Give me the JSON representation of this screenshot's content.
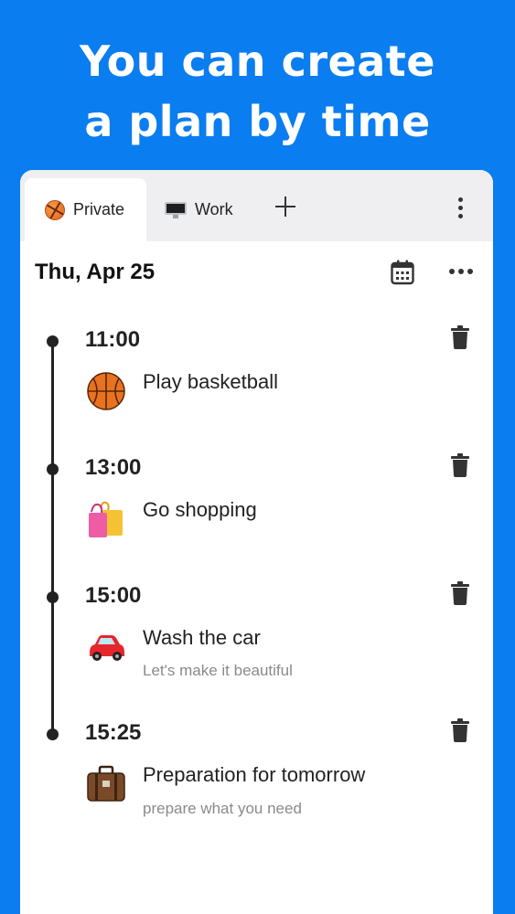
{
  "headline": {
    "line1": "You can create",
    "line2": "a plan by time"
  },
  "tabs": [
    {
      "label": "Private",
      "icon": "basketball-icon",
      "active": true
    },
    {
      "label": "Work",
      "icon": "computer-monitor-icon",
      "active": false
    }
  ],
  "header": {
    "date": "Thu, Apr 25"
  },
  "entries": [
    {
      "time": "11:00",
      "title": "Play basketball",
      "subtitle": "",
      "icon": "basketball-icon"
    },
    {
      "time": "13:00",
      "title": "Go shopping",
      "subtitle": "",
      "icon": "shopping-bags-icon"
    },
    {
      "time": "15:00",
      "title": "Wash the car",
      "subtitle": "Let's make it beautiful",
      "icon": "car-icon"
    },
    {
      "time": "15:25",
      "title": "Preparation for tomorrow",
      "subtitle": "prepare what you need",
      "icon": "suitcase-icon"
    }
  ],
  "colors": {
    "background": "#0a7df0",
    "tabbar": "#efeff1",
    "timeline": "#222222",
    "subtitle": "#8a8a8a"
  }
}
